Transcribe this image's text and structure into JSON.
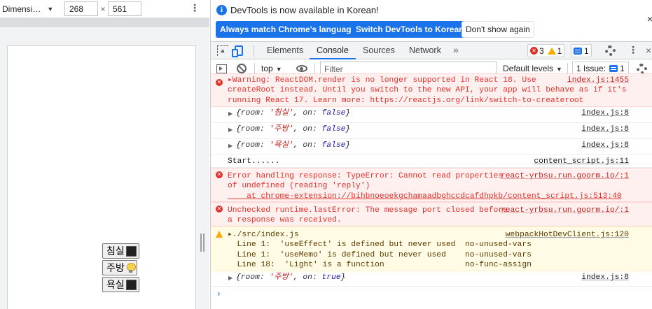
{
  "device_toolbar": {
    "dimensions_label": "Dimensi…",
    "width_value": "268",
    "times": "×",
    "height_value": "561",
    "more": "⋮"
  },
  "page": {
    "buttons": [
      {
        "label": "침실",
        "icon": "black-square"
      },
      {
        "label": "주방",
        "icon": "light-bulb"
      },
      {
        "label": "욕실",
        "icon": "black-square"
      }
    ]
  },
  "infobar": {
    "text": "DevTools is now available in Korean!",
    "btn_match": "Always match Chrome's language",
    "btn_switch": "Switch DevTools to Korean",
    "btn_dont": "Don't show again",
    "close": "×"
  },
  "tabs": {
    "items": [
      "Elements",
      "Console",
      "Sources",
      "Network"
    ],
    "active": "Console",
    "more": "»",
    "error_count": "3",
    "warning_count": "1",
    "message_count": "1",
    "menu": "⋮",
    "close": "×"
  },
  "toolbar": {
    "context": "top",
    "filter_placeholder": "Filter",
    "levels": "Default levels",
    "issues": "1 Issue:",
    "issues_count": "1"
  },
  "console": {
    "rows": [
      {
        "lines": [
          "▸Warning: ReactDOM.render is no longer supported in React 18. Use",
          "createRoot instead. Until you switch to the new API, your app will behave as if it's",
          "running React 17. Learn more: https://reactjs.org/link/switch-to-createroot"
        ],
        "source": "index.js:1455"
      },
      {
        "room": "'침실'",
        "on": "false",
        "source": "index.js:8"
      },
      {
        "room": "'주방'",
        "on": "false",
        "source": "index.js:8"
      },
      {
        "room": "'욕실'",
        "on": "false",
        "source": "index.js:8"
      },
      {
        "text": "Start......",
        "source": "content_script.js:11"
      },
      {
        "lines": [
          "Error handling response: TypeError: Cannot read properties",
          "of undefined (reading 'reply')",
          "    at chrome-extension://bihbnoeoekgchamaadbghccdcafdhpkb/content_script.js:513:40"
        ],
        "source": "react-yrbsu.run.goorm.io/:1"
      },
      {
        "lines": [
          "Unchecked runtime.lastError: The message port closed before",
          "a response was received."
        ],
        "source": "react-yrbsu.run.goorm.io/:1"
      },
      {
        "lines": [
          "▸./src/index.js",
          "  Line 1:  'useEffect' is defined but never used  no-unused-vars",
          "  Line 1:  'useMemo' is defined but never used    no-unused-vars",
          "  Line 18:  'Light' is a function                 no-func-assign"
        ],
        "source": "webpackHotDevClient.js:120"
      },
      {
        "room": "'주방'",
        "on": "true",
        "source": "index.js:8"
      }
    ],
    "prompt": "›"
  },
  "colors": {
    "accent": "#1a73e8",
    "error_bg": "#fff0f0",
    "error_text": "#e3312a",
    "warning_bg": "#fffbe5"
  }
}
